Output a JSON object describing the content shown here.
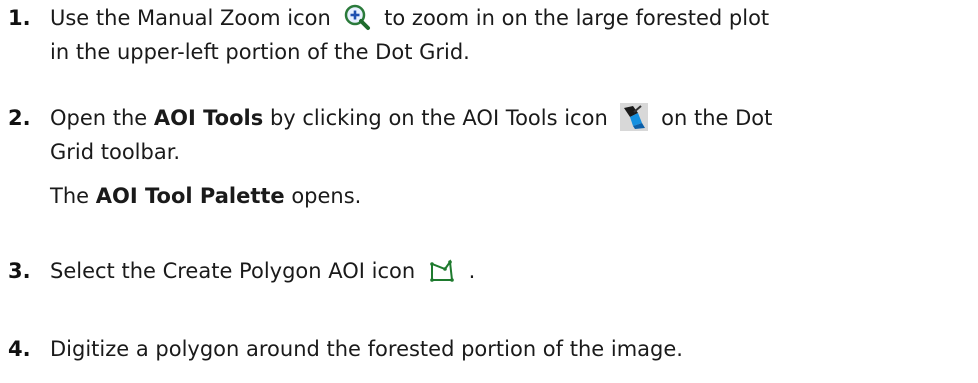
{
  "steps": [
    {
      "num": "1.",
      "pre": "Use the Manual Zoom icon",
      "post": "to zoom in on the large forested plot",
      "line2": "in the upper-left portion of the Dot Grid.",
      "icon": "zoom-in-icon"
    },
    {
      "num": "2.",
      "pre": "Open the",
      "bold1": "AOI Tools",
      "mid": "by clicking on the AOI Tools icon",
      "post": "on the Dot",
      "line2": "Grid toolbar.",
      "result_pre": "The",
      "result_bold": "AOI Tool Palette",
      "result_post": "opens.",
      "icon": "aoi-tools-icon"
    },
    {
      "num": "3.",
      "pre": "Select the Create Polygon AOI icon",
      "post": ".",
      "icon": "create-polygon-aoi-icon"
    },
    {
      "num": "4.",
      "text": "Digitize a polygon around the forested portion of the image."
    }
  ]
}
